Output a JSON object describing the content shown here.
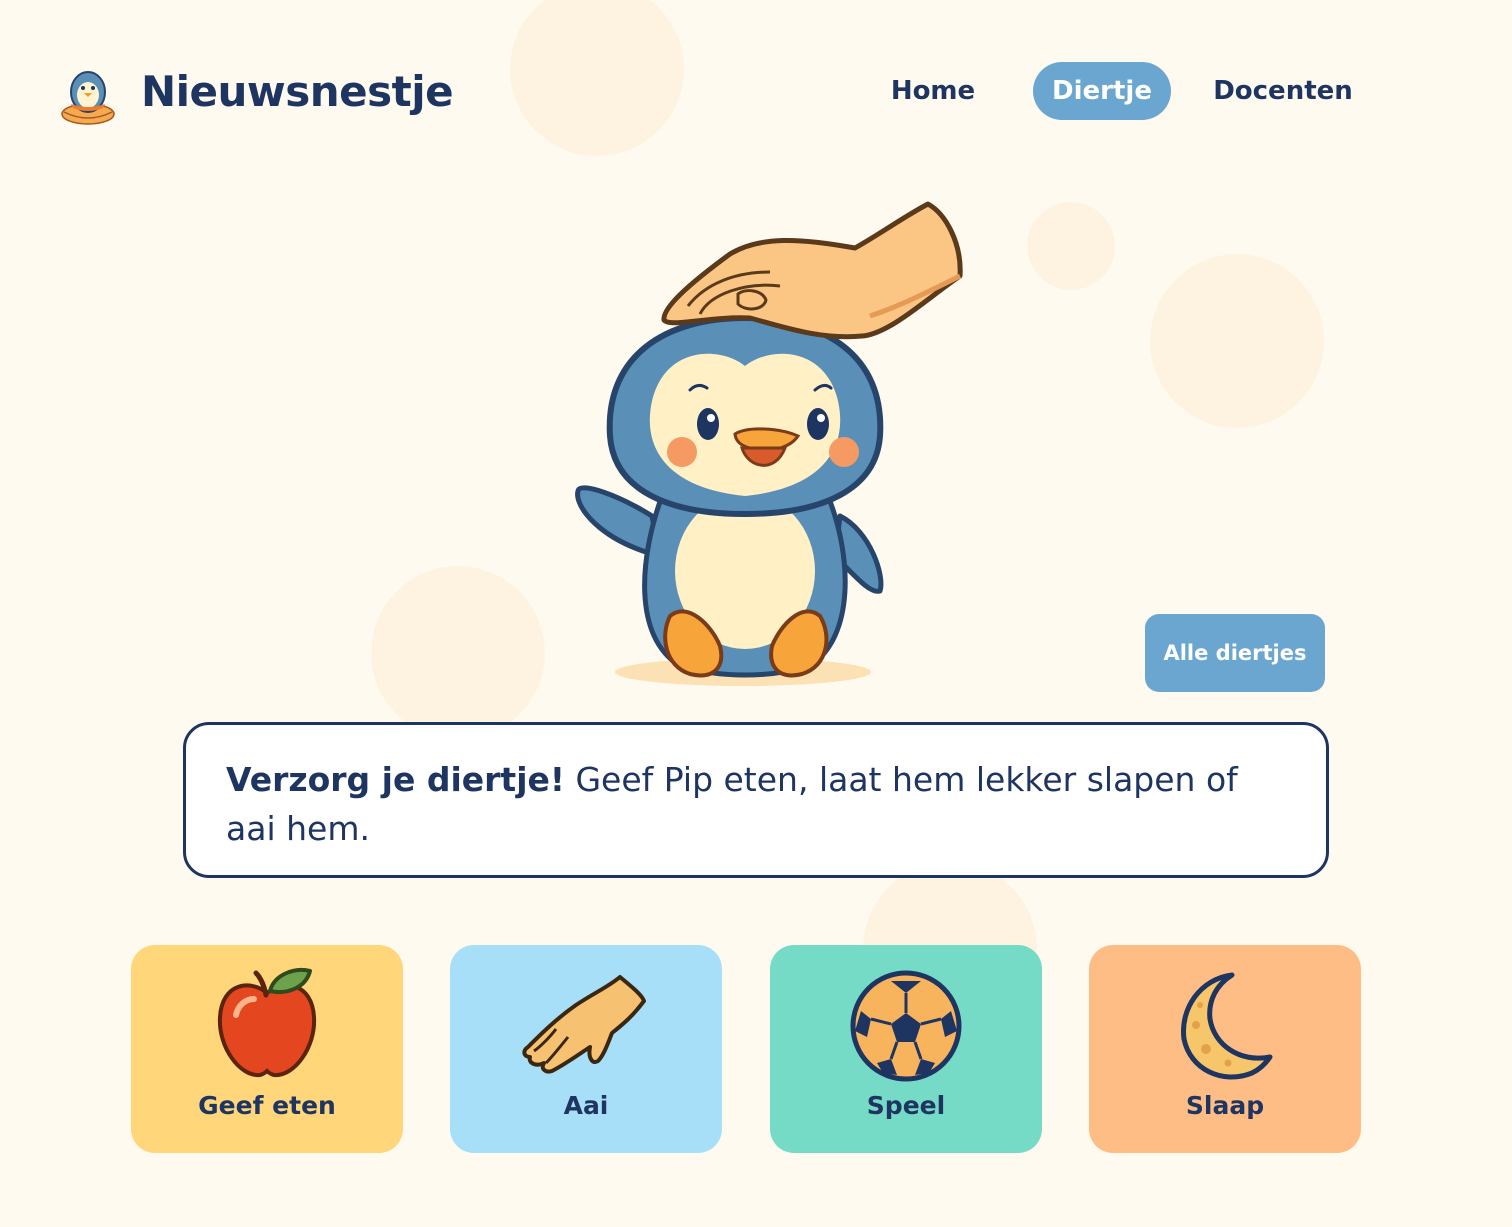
{
  "brand": {
    "name": "Nieuwsnestje"
  },
  "nav": [
    {
      "label": "Home",
      "active": false
    },
    {
      "label": "Diertje",
      "active": true
    },
    {
      "label": "Docenten",
      "active": false
    }
  ],
  "pet": {
    "all_button_label": "Alle diertjes"
  },
  "instruction": {
    "title": "Verzorg je diertje!",
    "text": " Geef Pip eten, laat hem lekker slapen of aai hem."
  },
  "actions": [
    {
      "label": "Geef eten",
      "icon": "apple-icon",
      "color": "#ffd67a"
    },
    {
      "label": "Aai",
      "icon": "hand-icon",
      "color": "#a6dff7"
    },
    {
      "label": "Speel",
      "icon": "ball-icon",
      "color": "#76dbc6"
    },
    {
      "label": "Slaap",
      "icon": "moon-icon",
      "color": "#ffbd86"
    }
  ],
  "colors": {
    "background": "#fffaef",
    "navy": "#1e3461",
    "accent_blue": "#6aa6d0"
  }
}
